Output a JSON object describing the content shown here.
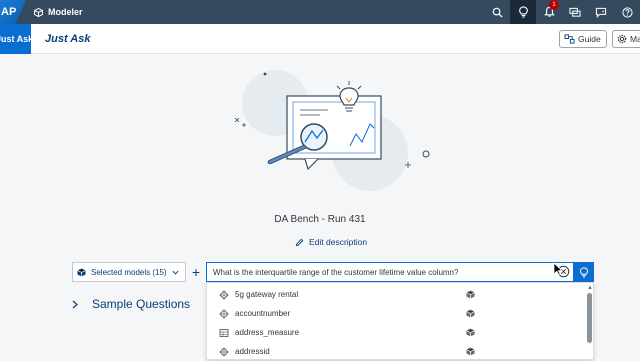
{
  "shell": {
    "logo": "AP",
    "app_name": "Modeler",
    "notification_count": "1",
    "icons": [
      "search-icon",
      "lightbulb-icon",
      "bell-icon",
      "feedback-icon",
      "chat-icon",
      "help-icon"
    ]
  },
  "subbar": {
    "active_tab": "Just Ask",
    "title": "Just Ask",
    "guide_label": "Guide",
    "settings_label": "Ma"
  },
  "main": {
    "run_title": "DA Bench - Run 431",
    "edit_description": "Edit description"
  },
  "query": {
    "selected_models": "Selected models (15)",
    "input_value": "What is the interquartile range of the customer lifetime value column?",
    "sample_questions": "Sample Questions"
  },
  "dropdown": {
    "items": [
      {
        "label": "5g gateway rental",
        "icon": "dimension-icon"
      },
      {
        "label": "accountnumber",
        "icon": "dimension-icon"
      },
      {
        "label": "address_measure",
        "icon": "measure-icon"
      },
      {
        "label": "addressid",
        "icon": "dimension-icon"
      }
    ]
  },
  "colors": {
    "shell_bg": "#354a5f",
    "accent": "#0a6ed1",
    "link": "#0a3f7a"
  }
}
